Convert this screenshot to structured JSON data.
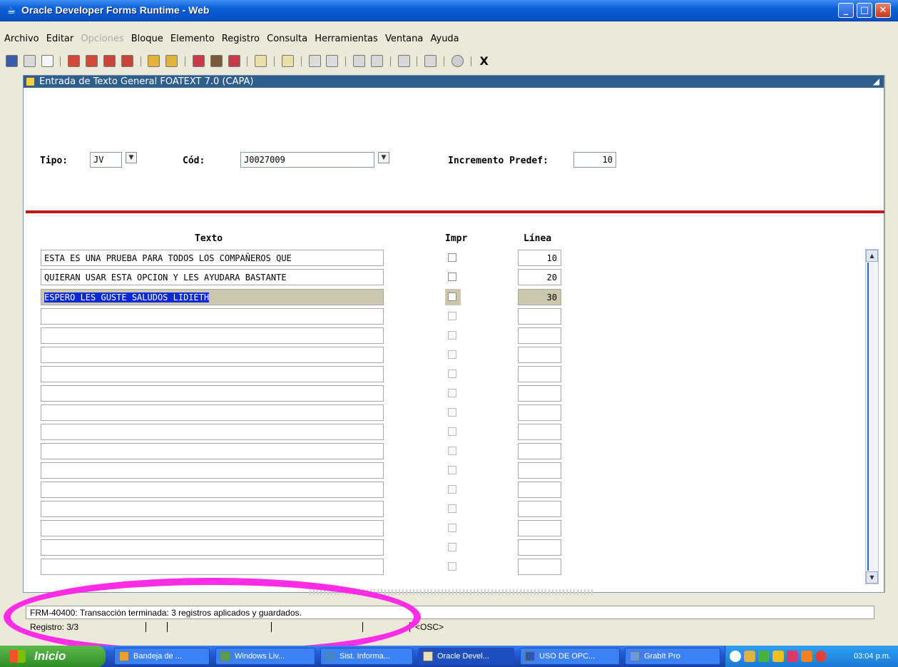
{
  "window": {
    "title": "Oracle Developer Forms Runtime - Web"
  },
  "menu": [
    "Archivo",
    "Editar",
    "Opciones",
    "Bloque",
    "Elemento",
    "Registro",
    "Consulta",
    "Herramientas",
    "Ventana",
    "Ayuda"
  ],
  "toolbar": {
    "exit_label": "X"
  },
  "form": {
    "title": "Entrada de Texto General  FOATEXT  7.0  (CAPA)",
    "tipo_label": "Tipo:",
    "tipo_value": "JV",
    "cod_label": "Cód:",
    "cod_value": "J0027009",
    "incremento_label": "Incremento Predef:",
    "incremento_value": "10",
    "col_texto": "Texto",
    "col_impr": "Impr",
    "col_linea": "Línea",
    "rows": [
      {
        "texto": "ESTA ES UNA PRUEBA PARA TODOS LOS COMPAÑEROS QUE",
        "linea": "10"
      },
      {
        "texto": "QUIERAN USAR ESTA OPCION Y LES AYUDARA BASTANTE",
        "linea": "20"
      },
      {
        "texto": "ESPERO LES GUSTE  SALUDOS  LIDIETH",
        "linea": "30"
      }
    ]
  },
  "status": {
    "message": "FRM-40400: Transacción terminada: 3 registros aplicados y guardados.",
    "record": "Registro: 3/3",
    "mode": "<OSC>"
  },
  "taskbar": {
    "start_label": "Inicio",
    "tasks": [
      "Bandeja de ...",
      "Windows Liv...",
      "Sist. Informa...",
      "Oracle Devel...",
      "USO DE OPC...",
      "GrabIt Pro"
    ],
    "clock": "03:04 p.m."
  },
  "colors": {
    "titlebar": "#0a5fd6",
    "selection": "#0b2ad6",
    "current_row": "#cbc8ad",
    "divider": "#c11b17",
    "annotation": "#ff2ce6"
  }
}
